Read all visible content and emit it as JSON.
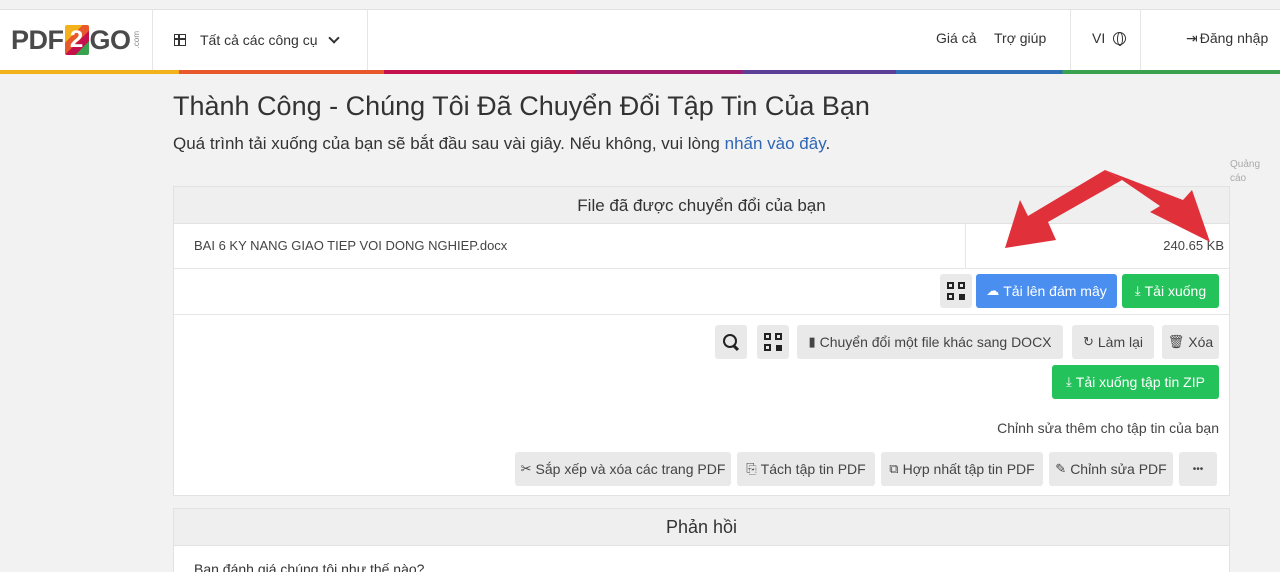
{
  "header": {
    "logo_text_left": "PDF",
    "logo_text_2": "2",
    "logo_text_right": "GO",
    "logo_com": ".com",
    "tools_menu_label": "Tất cả các công cụ",
    "nav": {
      "pricing": "Giá cả",
      "help": "Trợ giúp",
      "language": "VI",
      "login": "Đăng nhập"
    }
  },
  "main": {
    "title": "Thành Công - Chúng Tôi Đã Chuyển Đổi Tập Tin Của Bạn",
    "subtitle_before": "Quá trình tải xuống của bạn sẽ bắt đầu sau vài giây. Nếu không, vui lòng ",
    "subtitle_link": "nhấn vào đây",
    "subtitle_after": ".",
    "ad_label": "Quảng cáo"
  },
  "converted_card": {
    "heading": "File đã được chuyển đổi của bạn",
    "file_name": "BAI 6 KY NANG GIAO TIEP VOI DONG NGHIEP.docx",
    "file_size": "240.65 KB",
    "upload_cloud_label": "Tải lên đám mây",
    "download_label": "Tải xuống",
    "convert_another_label": "Chuyển đổi một file khác sang DOCX",
    "redo_label": "Làm lại",
    "delete_label": "Xóa",
    "download_zip_label": "Tải xuống tập tin ZIP",
    "edit_more_label": "Chỉnh sửa thêm cho tập tin của bạn",
    "edit_tools": {
      "sort_delete": "Sắp xếp và xóa các trang PDF",
      "split": "Tách tập tin PDF",
      "merge": "Hợp nhất tập tin PDF",
      "edit": "Chỉnh sửa PDF",
      "more": "•••"
    }
  },
  "feedback_card": {
    "heading": "Phản hồi",
    "question": "Bạn đánh giá chúng tôi như thế nào?"
  },
  "colors": {
    "blue_button": "#4a8ff0",
    "green_button": "#23c25a",
    "link": "#2f66b5",
    "annotation_arrow": "#e0303a"
  }
}
